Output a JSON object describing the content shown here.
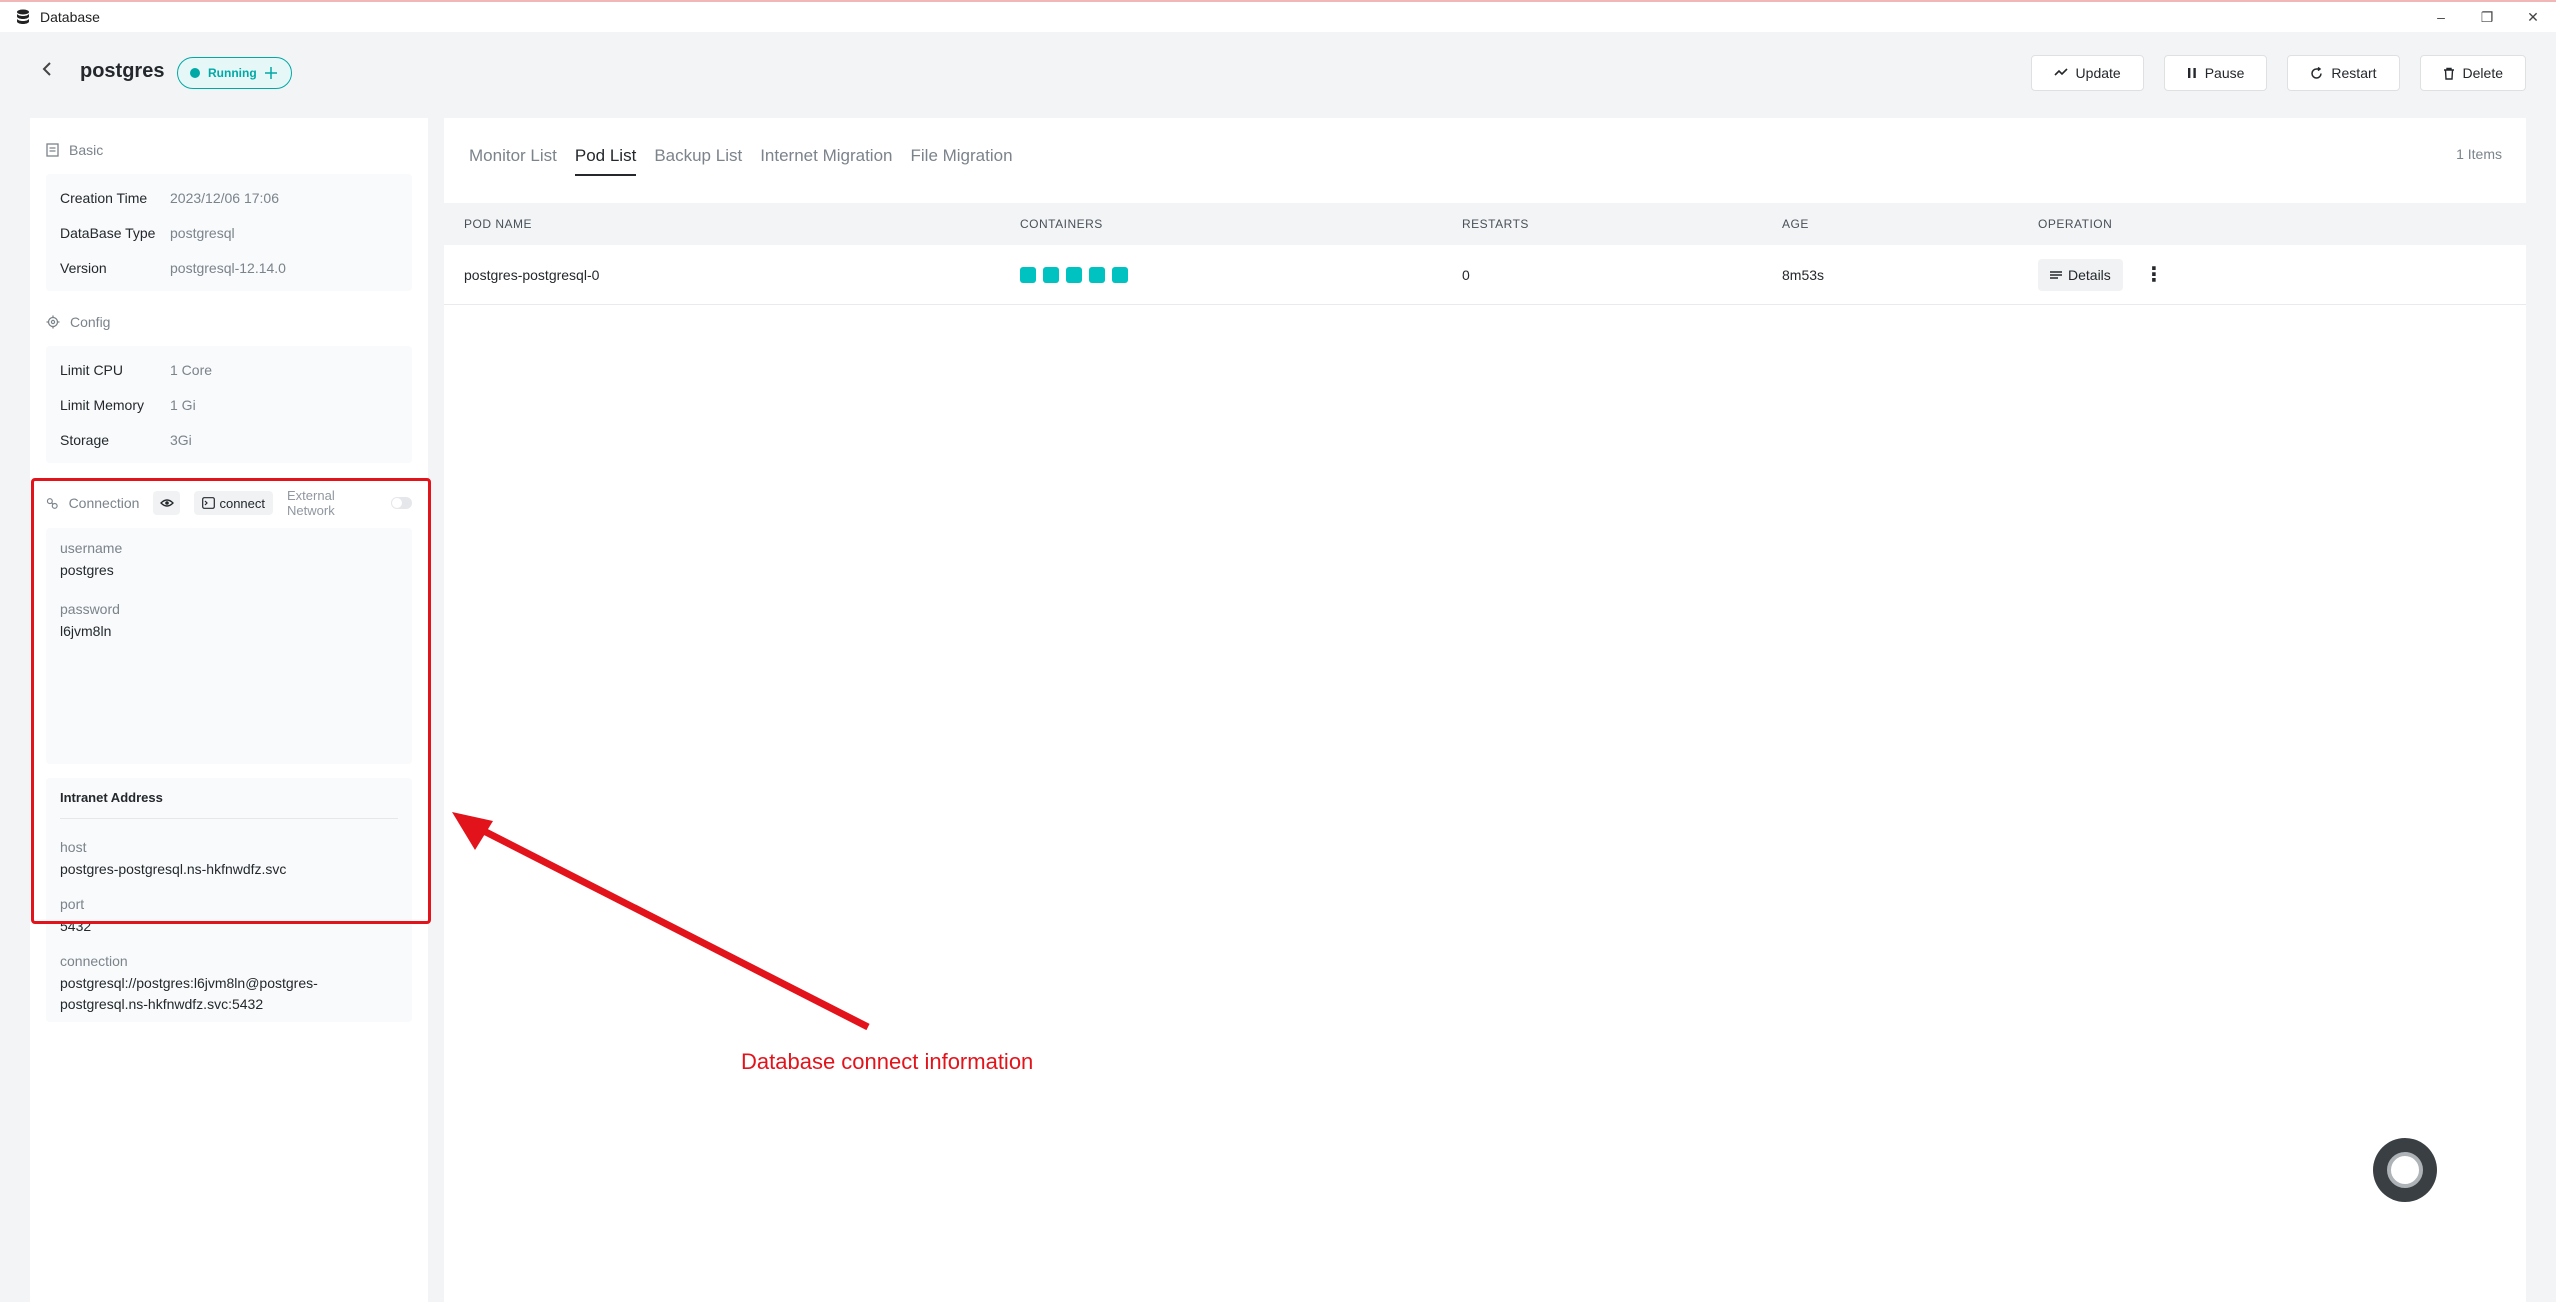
{
  "window": {
    "title": "Database",
    "minimize": "–",
    "restore": "❐",
    "close": "✕"
  },
  "header": {
    "name": "postgres",
    "status": "Running",
    "buttons": {
      "update": "Update",
      "pause": "Pause",
      "restart": "Restart",
      "delete": "Delete"
    }
  },
  "sidebar": {
    "basic": {
      "title": "Basic",
      "rows": [
        {
          "label": "Creation Time",
          "value": "2023/12/06 17:06"
        },
        {
          "label": "DataBase Type",
          "value": "postgresql"
        },
        {
          "label": "Version",
          "value": "postgresql-12.14.0"
        }
      ]
    },
    "config": {
      "title": "Config",
      "rows": [
        {
          "label": "Limit CPU",
          "value": "1 Core"
        },
        {
          "label": "Limit Memory",
          "value": "1 Gi"
        },
        {
          "label": "Storage",
          "value": "3Gi"
        }
      ]
    },
    "connection": {
      "title": "Connection",
      "connect_label": "connect",
      "external_label": "External Network",
      "username_label": "username",
      "username": "postgres",
      "password_label": "password",
      "password": "l6jvm8ln",
      "intranet_title": "Intranet Address",
      "host_label": "host",
      "host": "postgres-postgresql.ns-hkfnwdfz.svc",
      "port_label": "port",
      "port": "5432",
      "conn_label": "connection",
      "conn_line1": "postgresql://postgres:l6jvm8ln@postgres-",
      "conn_line2": "postgresql.ns-hkfnwdfz.svc:5432"
    }
  },
  "main": {
    "tabs": [
      "Monitor List",
      "Pod List",
      "Backup List",
      "Internet Migration",
      "File Migration"
    ],
    "active_tab": "Pod List",
    "items_count": "1 Items",
    "columns": [
      "POD NAME",
      "CONTAINERS",
      "RESTARTS",
      "AGE",
      "OPERATION"
    ],
    "rows": [
      {
        "pod_name": "postgres-postgresql-0",
        "containers": 5,
        "restarts": "0",
        "age": "8m53s",
        "details": "Details"
      }
    ]
  },
  "annotation": {
    "text": "Database connect information",
    "color": "#e3131b"
  },
  "colors": {
    "accent": "#00a9a6",
    "container": "#00c2c0"
  }
}
